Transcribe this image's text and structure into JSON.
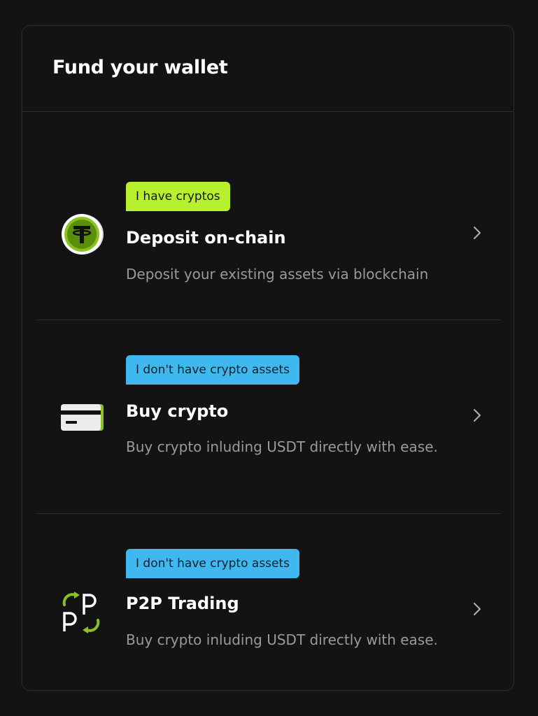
{
  "panel": {
    "title": "Fund your wallet"
  },
  "options": [
    {
      "badge": "I have cryptos",
      "badge_color": "#b6f02f",
      "title": "Deposit on-chain",
      "description": "Deposit your existing assets via blockchain",
      "icon": "tether-coin-icon"
    },
    {
      "badge": "I don't have crypto assets",
      "badge_color": "#3eb8ee",
      "title": "Buy crypto",
      "description": "Buy crypto inluding USDT directly with ease.",
      "icon": "credit-card-icon"
    },
    {
      "badge": "I don't have crypto assets",
      "badge_color": "#3eb8ee",
      "title": "P2P Trading",
      "description": "Buy crypto inluding USDT directly with ease.",
      "icon": "p2p-icon"
    }
  ],
  "colors": {
    "background": "#131313",
    "accent_lime": "#b6f02f",
    "accent_blue": "#3eb8ee",
    "text_secondary": "#9a9a9a",
    "divider": "#2c2c2c"
  }
}
